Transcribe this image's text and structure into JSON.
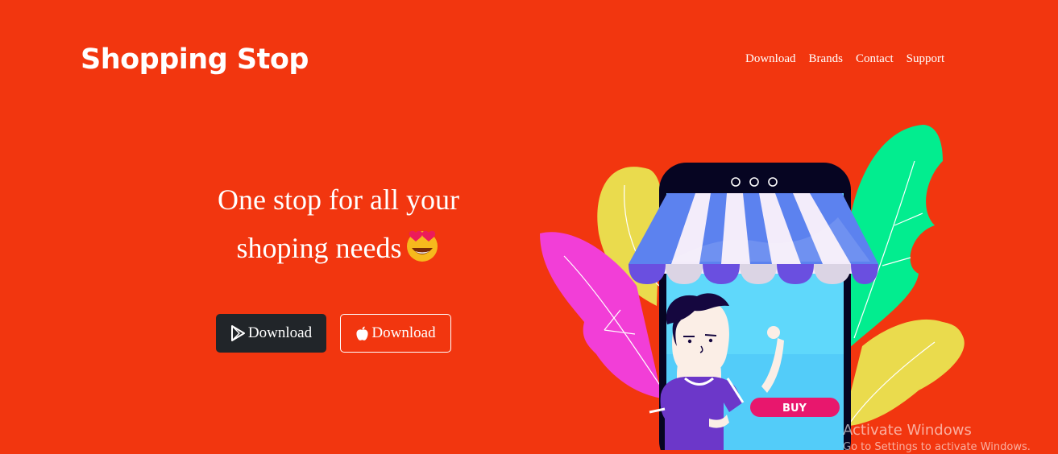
{
  "brand": "Shopping Stop",
  "nav": {
    "download": "Download",
    "brands": "Brands",
    "contact": "Contact",
    "support": "Support"
  },
  "hero": {
    "line1": "One stop for all your",
    "line2": "shoping needs",
    "emoji_icon": "star-struck-emoji-icon",
    "play_button": "Download",
    "apple_button": "Download",
    "buy_label": "BUY"
  },
  "watermark": {
    "line1": "Activate Windows",
    "line2": "Go to Settings to activate Windows."
  },
  "colors": {
    "background": "#f2360f",
    "dark_button": "#212529",
    "buy_button": "#e8176d"
  }
}
